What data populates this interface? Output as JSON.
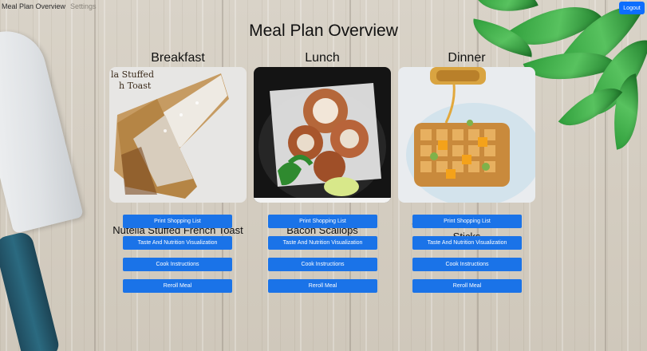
{
  "nav": {
    "brand": "Meal Plan Overview",
    "settings": "Settings",
    "logout": "Logout"
  },
  "page_title": "Meal Plan Overview",
  "meals": [
    {
      "heading": "Breakfast",
      "name": "Nutella Stuffed French Toast",
      "photo_caption": "la Stuffed\nh Toast",
      "buttons": [
        "Print Shopping List",
        "Taste And Nutrition Visualization",
        "Cook Instructions",
        "Reroll Meal"
      ]
    },
    {
      "heading": "Lunch",
      "name": "Bacon Scallops",
      "buttons": [
        "Print Shopping List",
        "Taste And Nutrition Visualization",
        "Cook Instructions",
        "Reroll Meal"
      ]
    },
    {
      "heading": "Dinner",
      "name": "Cinnamon French Toast Sticks",
      "buttons": [
        "Print Shopping List",
        "Taste And Nutrition Visualization",
        "Cook Instructions",
        "Reroll Meal"
      ]
    }
  ],
  "colors": {
    "button": "#1a73e8",
    "logout": "#0d6efd"
  },
  "icons": {
    "decor_left": "knife-illustration",
    "decor_right": "green-leaves-illustration"
  }
}
